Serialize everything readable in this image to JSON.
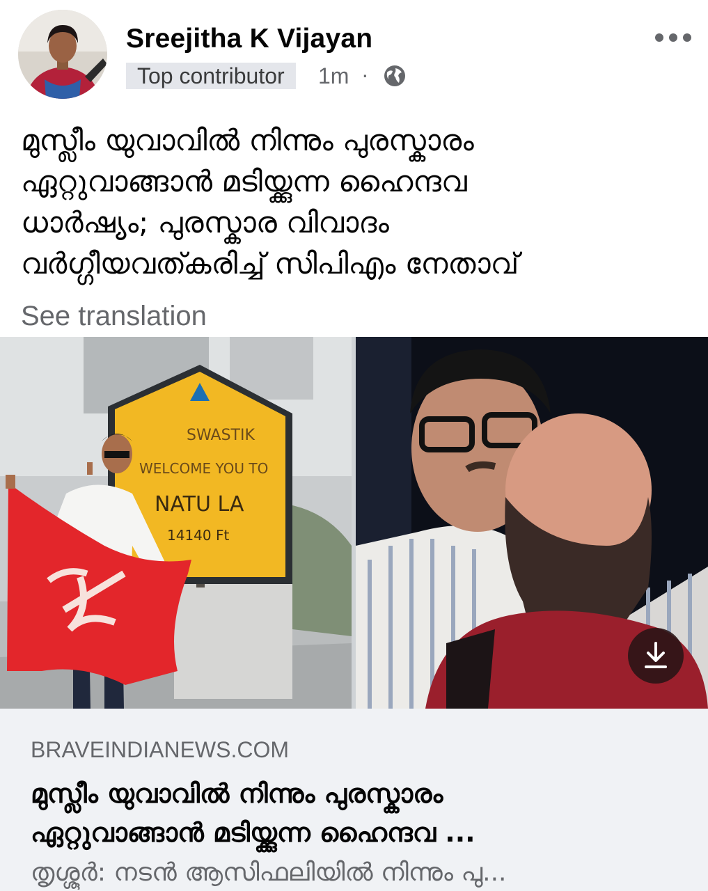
{
  "post": {
    "author": "Sreejitha K Vijayan",
    "badge": "Top contributor",
    "time": "1m",
    "separator": "·",
    "audience_icon": "globe-icon",
    "more_icon": "ellipsis-icon",
    "text_lines": [
      "മുസ്ലീം യുവാവിൽ നിന്നും പുരസ്കാരം",
      "ഏറ്റുവാങ്ങാൻ മടിയ്ക്കുന്ന ഹൈന്ദവ",
      "ധാർഷ്യം; പുരസ്കാര വിവാദം",
      "വർഗ്ഗീയവത്കരിച്ച് സിപിഎം നേതാവ്"
    ],
    "see_translation": "See translation"
  },
  "media": {
    "left_photo_sign": [
      "SWASTIK",
      "WELCOME YOU TO",
      "NATU LA",
      "14140 Ft"
    ],
    "download_icon": "download-icon"
  },
  "link_preview": {
    "domain": "BRAVEINDIANEWS.COM",
    "title_lines": [
      "മുസ്ലീം യുവാവിൽ നിന്നും പുരസ്കാരം",
      "ഏറ്റുവാങ്ങാൻ മടിയ്ക്കുന്ന ഹൈന്ദവ ..."
    ],
    "description": "തൃശ്ശൂർ: നടൻ ആസിഫലിയിൽ നിന്നും പു..."
  },
  "colors": {
    "text_primary": "#050505",
    "text_secondary": "#65676b",
    "badge_bg": "#e4e6eb",
    "card_bg": "#f0f2f5",
    "flag_red": "#e3262b",
    "sign_yellow": "#f2b823"
  }
}
